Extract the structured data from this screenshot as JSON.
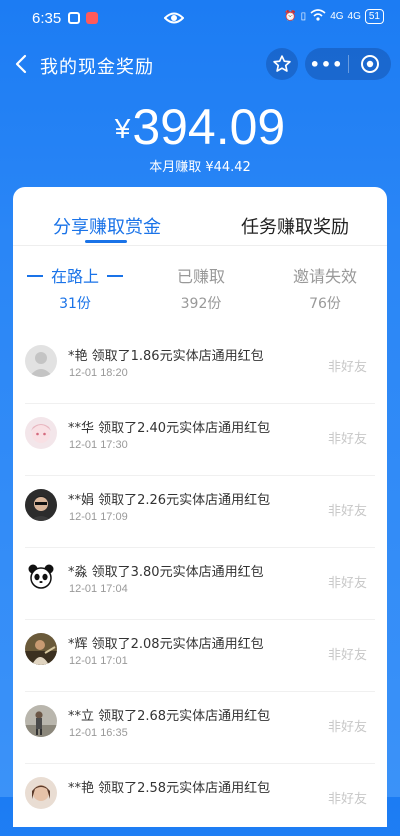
{
  "status": {
    "time": "6:35",
    "battery": "51",
    "network": "4G"
  },
  "header": {
    "title": "我的现金奖励"
  },
  "summary": {
    "currency": "¥",
    "amount": "394.09",
    "month_earned": "本月赚取 ¥44.42"
  },
  "tabs": [
    {
      "label": "分享赚取赏金",
      "active": true
    },
    {
      "label": "任务赚取奖励",
      "active": false
    }
  ],
  "stats": [
    {
      "label": "在路上",
      "count": "31份",
      "active": true
    },
    {
      "label": "已赚取",
      "count": "392份",
      "active": false
    },
    {
      "label": "邀请失效",
      "count": "76份",
      "active": false
    }
  ],
  "records": [
    {
      "desc": "*艳 领取了1.86元实体店通用红包",
      "time": "12-01 18:20",
      "tag": "非好友",
      "avatar": "default"
    },
    {
      "desc": "**华 领取了2.40元实体店通用红包",
      "time": "12-01 17:30",
      "tag": "非好友",
      "avatar": "pink"
    },
    {
      "desc": "**娟 领取了2.26元实体店通用红包",
      "time": "12-01 17:09",
      "tag": "非好友",
      "avatar": "dark"
    },
    {
      "desc": "*淼 领取了3.80元实体店通用红包",
      "time": "12-01 17:04",
      "tag": "非好友",
      "avatar": "panda"
    },
    {
      "desc": "*辉 领取了2.08元实体店通用红包",
      "time": "12-01 17:01",
      "tag": "非好友",
      "avatar": "outdoor"
    },
    {
      "desc": "**立 领取了2.68元实体店通用红包",
      "time": "12-01 16:35",
      "tag": "非好友",
      "avatar": "street"
    },
    {
      "desc": "**艳 领取了2.58元实体店通用红包",
      "time": "",
      "tag": "非好友",
      "avatar": "girl"
    }
  ],
  "colors": {
    "brand_blue": "#1a73e8",
    "bg_gradient_top": "#1c7cf3"
  }
}
